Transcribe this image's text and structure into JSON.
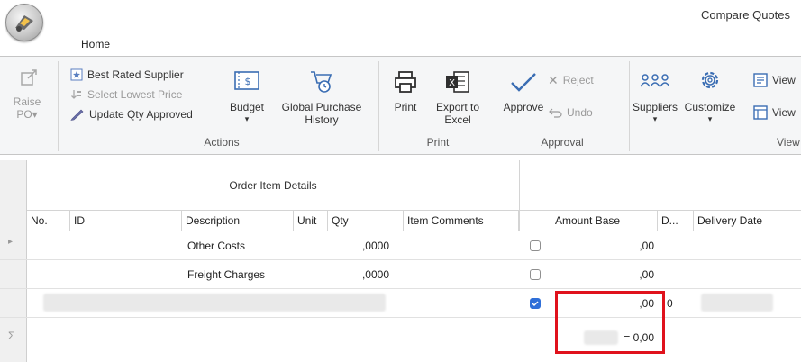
{
  "window": {
    "title": "Compare Quotes"
  },
  "app": {
    "orb_icon": "app-orb-icon"
  },
  "tabs": [
    {
      "label": "Home",
      "active": true
    }
  ],
  "ribbon": {
    "raise_po": {
      "label_line1": "Raise",
      "label_line2": "PO▾",
      "icon": "raise-po-icon",
      "enabled": false
    },
    "actions": {
      "group_label": "Actions",
      "best_rated_supplier": "Best Rated Supplier",
      "select_lowest_price": "Select Lowest Price",
      "update_qty_approved": "Update Qty Approved",
      "budget": {
        "label": "Budget",
        "arrow": "▾"
      },
      "global_purchase_history": {
        "line1": "Global Purchase",
        "line2": "History"
      }
    },
    "print": {
      "group_label": "Print",
      "print": "Print",
      "export_to_excel": {
        "line1": "Export to",
        "line2": "Excel"
      }
    },
    "approval": {
      "group_label": "Approval",
      "approve": "Approve",
      "reject": "Reject",
      "undo": "Undo"
    },
    "view": {
      "group_label": "View",
      "suppliers": {
        "label": "Suppliers",
        "arrow": "▾"
      },
      "customize": {
        "label": "Customize",
        "arrow": "▾"
      },
      "view1": "View",
      "view2": "View"
    }
  },
  "grid": {
    "band_title": "Order Item Details",
    "columns": [
      "No.",
      "ID",
      "Description",
      "Unit",
      "Qty",
      "Item Comments",
      "",
      "Amount Base",
      "D...",
      "Delivery Date"
    ],
    "rows": [
      {
        "description": "Other Costs",
        "qty": ",0000",
        "checked": false,
        "amount": ",00"
      },
      {
        "description": "Freight Charges",
        "qty": ",0000",
        "checked": false,
        "amount": ",00"
      },
      {
        "description": "",
        "qty": "",
        "checked": true,
        "amount": ",00",
        "d": "0"
      }
    ],
    "summary": {
      "symbol": "Σ",
      "total": "= 0,00"
    },
    "row_indicator": "▸",
    "highlight_color": "#e0121c",
    "accent_color": "#2f6fd8"
  }
}
